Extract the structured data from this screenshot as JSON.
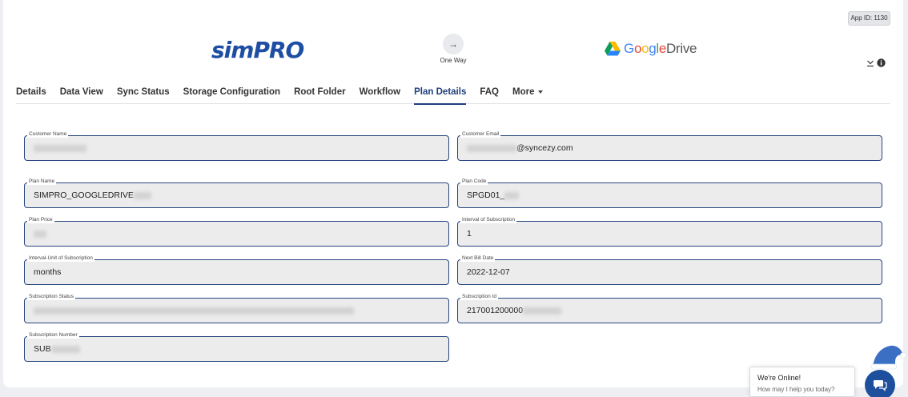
{
  "header": {
    "app_id": "App ID: 1130",
    "source_logo_text": "simPRO",
    "sync_direction": "One Way",
    "destination_logo_text": "GoogleDrive",
    "colors": {
      "simpro_blue": "#1d4ea3",
      "active_tab": "#1d3f7a",
      "field_border": "#27467e"
    }
  },
  "tabs": [
    {
      "label": "Details"
    },
    {
      "label": "Data View"
    },
    {
      "label": "Sync Status"
    },
    {
      "label": "Storage Configuration"
    },
    {
      "label": "Root Folder"
    },
    {
      "label": "Workflow"
    },
    {
      "label": "Plan Details"
    },
    {
      "label": "FAQ"
    },
    {
      "label": "More"
    }
  ],
  "active_tab": "Plan Details",
  "fields": {
    "customer_name": {
      "label": "Customer Name",
      "value": ""
    },
    "customer_email": {
      "label": "Customer Email",
      "value": "@syncezy.com"
    },
    "plan_name": {
      "label": "Plan Name",
      "value": "SIMPRO_GOOGLEDRIVE"
    },
    "plan_code": {
      "label": "Plan Code",
      "value": "SPGD01_"
    },
    "plan_price": {
      "label": "Plan Price",
      "value": ""
    },
    "interval": {
      "label": "Interval of Subscription",
      "value": "1"
    },
    "interval_unit": {
      "label": "Interval-Unit of Subscription",
      "value": "months"
    },
    "next_bill_date": {
      "label": "Next Bill Date",
      "value": "2022-12-07"
    },
    "subscription_status": {
      "label": "Subscription Status",
      "value": ""
    },
    "subscription_id": {
      "label": "Subscription Id",
      "value": "217001200000"
    },
    "subscription_number": {
      "label": "Subscription Number",
      "value": "SUB"
    }
  },
  "chat": {
    "title": "We're Online!",
    "subtitle": "How may I help you today?"
  },
  "icons": [
    "arrow-right-icon",
    "google-drive-icon",
    "download-icon",
    "info-icon",
    "chat-icon",
    "santa-hat-icon",
    "gear-icon"
  ]
}
